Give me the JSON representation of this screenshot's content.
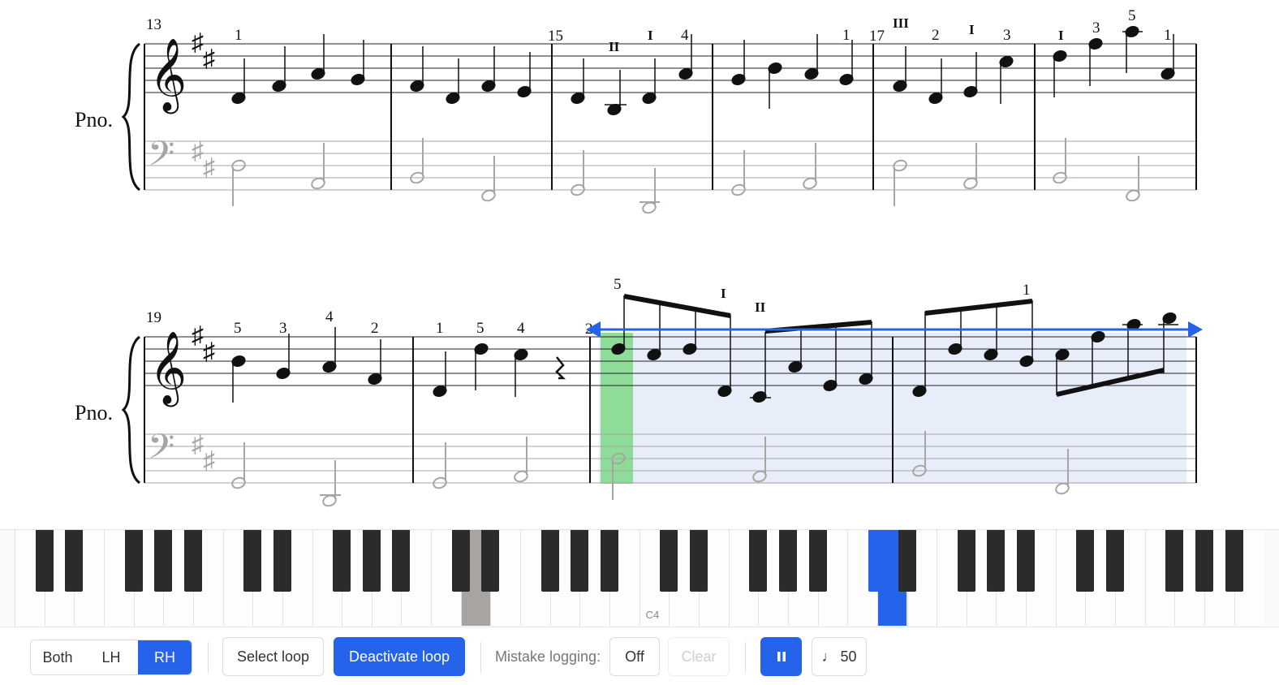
{
  "score": {
    "instrument": "Pno.",
    "measure_numbers": [
      "13",
      "15",
      "17",
      "19",
      "21"
    ],
    "row1_fingerings": [
      "1",
      "4",
      "1",
      "2",
      "3",
      "3",
      "5",
      "1"
    ],
    "row1_strings": [
      "II",
      "I",
      "III",
      "I",
      "I"
    ],
    "row2_fingerings": [
      "5",
      "3",
      "4",
      "2",
      "1",
      "5",
      "4",
      "5",
      "1"
    ],
    "row2_strings": [
      "I",
      "II"
    ]
  },
  "piano": {
    "middle_c_label": "C4"
  },
  "toolbar": {
    "hands": {
      "both": "Both",
      "lh": "LH",
      "rh": "RH",
      "active": "RH"
    },
    "select_loop": "Select loop",
    "deactivate_loop": "Deactivate loop",
    "mistake_label": "Mistake logging:",
    "mistake_value": "Off",
    "clear": "Clear",
    "pause_icon": "pause-icon",
    "tempo": "♩ 50"
  },
  "colors": {
    "accent": "#2563eb",
    "loop_region": "#e8edfa",
    "playhead": "#8fdc98",
    "rh_note": "#111111",
    "lh_note": "#a8a4a2"
  }
}
